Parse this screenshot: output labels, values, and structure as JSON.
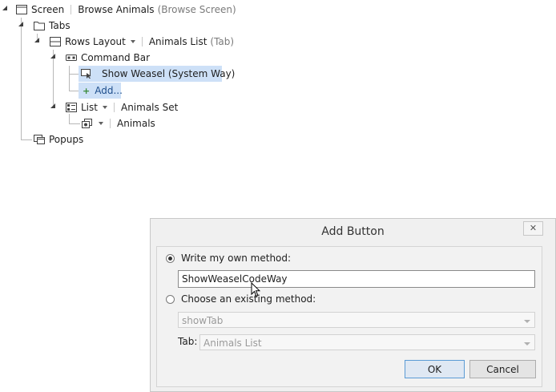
{
  "tree": {
    "screen": {
      "label": "Screen",
      "name": "Browse Animals",
      "type": "(Browse Screen)"
    },
    "tabs": {
      "label": "Tabs"
    },
    "rows_layout": {
      "label": "Rows Layout",
      "name": "Animals List",
      "type": "(Tab)"
    },
    "command_bar": {
      "label": "Command Bar"
    },
    "show_weasel": {
      "label": "Show Weasel (System Way)"
    },
    "add": {
      "label": "Add..."
    },
    "list": {
      "label": "List",
      "name": "Animals Set"
    },
    "animals": {
      "label": "Animals"
    },
    "popups": {
      "label": "Popups"
    }
  },
  "dialog": {
    "title": "Add Button",
    "close_glyph": "✕",
    "option_write": "Write my own method:",
    "method_name_value": "ShowWeaselCodeWay",
    "option_existing": "Choose an existing method:",
    "existing_method_value": "showTab",
    "tab_label": "Tab:",
    "tab_value": "Animals List",
    "ok_label": "OK",
    "cancel_label": "Cancel",
    "write_selected": true
  },
  "colors": {
    "selection": "#cde0f7",
    "default_button_border": "#5b9bd5"
  }
}
